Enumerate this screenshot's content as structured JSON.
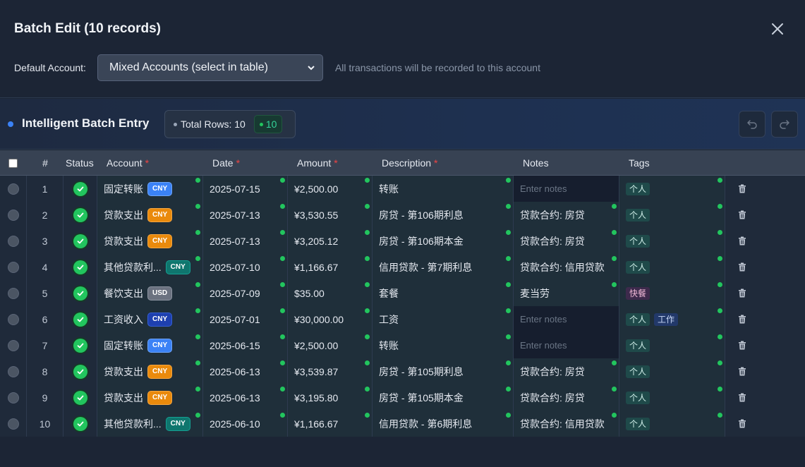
{
  "dialog": {
    "title": "Batch Edit (10 records)",
    "default_account_label": "Default Account:",
    "default_account_value": "Mixed Accounts (select in table)",
    "default_account_hint": "All transactions will be recorded to this account"
  },
  "toolbar": {
    "title": "Intelligent Batch Entry",
    "total_rows_label": "Total Rows: 10",
    "valid_count": "10"
  },
  "columns": {
    "num": "#",
    "status": "Status",
    "account": "Account",
    "date": "Date",
    "amount": "Amount",
    "description": "Description",
    "notes": "Notes",
    "tags": "Tags",
    "required_mark": "*"
  },
  "notes_placeholder": "Enter notes",
  "rows": [
    {
      "num": "1",
      "account": "固定转账",
      "currency": "CNY",
      "date": "2025-07-15",
      "amount": "¥2,500.00",
      "description": "转账",
      "notes": "",
      "tags": [
        "个人"
      ]
    },
    {
      "num": "2",
      "account": "贷款支出",
      "currency": "CNY",
      "date": "2025-07-13",
      "amount": "¥3,530.55",
      "description": "房贷 - 第106期利息",
      "notes": "贷款合约: 房贷",
      "tags": [
        "个人"
      ]
    },
    {
      "num": "3",
      "account": "贷款支出",
      "currency": "CNY",
      "date": "2025-07-13",
      "amount": "¥3,205.12",
      "description": "房贷 - 第106期本金",
      "notes": "贷款合约: 房贷",
      "tags": [
        "个人"
      ]
    },
    {
      "num": "4",
      "account": "其他贷款利...",
      "currency": "CNY",
      "date": "2025-07-10",
      "amount": "¥1,166.67",
      "description": "信用贷款 - 第7期利息",
      "notes": "贷款合约: 信用贷款",
      "tags": [
        "个人"
      ]
    },
    {
      "num": "5",
      "account": "餐饮支出",
      "currency": "USD",
      "date": "2025-07-09",
      "amount": "$35.00",
      "description": "套餐",
      "notes": "麦当劳",
      "tags": [
        "快餐"
      ]
    },
    {
      "num": "6",
      "account": "工资收入",
      "currency": "CNY",
      "date": "2025-07-01",
      "amount": "¥30,000.00",
      "description": "工资",
      "notes": "",
      "tags": [
        "个人",
        "工作"
      ]
    },
    {
      "num": "7",
      "account": "固定转账",
      "currency": "CNY",
      "date": "2025-06-15",
      "amount": "¥2,500.00",
      "description": "转账",
      "notes": "",
      "tags": [
        "个人"
      ]
    },
    {
      "num": "8",
      "account": "贷款支出",
      "currency": "CNY",
      "date": "2025-06-13",
      "amount": "¥3,539.87",
      "description": "房贷 - 第105期利息",
      "notes": "贷款合约: 房贷",
      "tags": [
        "个人"
      ]
    },
    {
      "num": "9",
      "account": "贷款支出",
      "currency": "CNY",
      "date": "2025-06-13",
      "amount": "¥3,195.80",
      "description": "房贷 - 第105期本金",
      "notes": "贷款合约: 房贷",
      "tags": [
        "个人"
      ]
    },
    {
      "num": "10",
      "account": "其他贷款利...",
      "currency": "CNY",
      "date": "2025-06-10",
      "amount": "¥1,166.67",
      "description": "信用贷款 - 第6期利息",
      "notes": "贷款合约: 信用贷款",
      "tags": [
        "个人"
      ]
    }
  ],
  "colors": {
    "background": "#1c2535",
    "valid_green": "#22c55e",
    "required_red": "#ef4444",
    "currency_cny_blue": "#3b82f6",
    "currency_cny_orange": "#ea8a0c",
    "currency_cny_teal": "#0f766e",
    "currency_usd_gray": "#6b7280",
    "currency_cny_navy": "#1e40af"
  }
}
